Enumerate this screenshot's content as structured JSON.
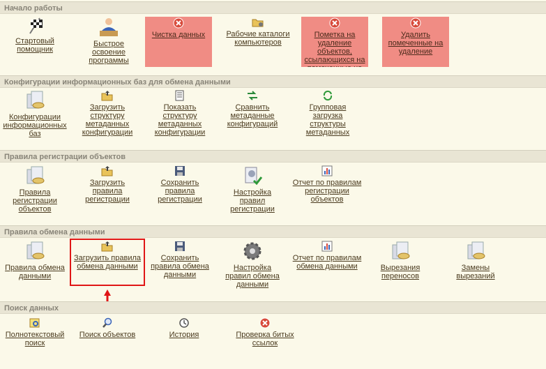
{
  "sections": [
    {
      "title": "Начало работы",
      "items": [
        {
          "label": "Стартовый помощник",
          "icon": "checkered-flag-icon"
        },
        {
          "label": "Быстрое освоение программы",
          "icon": "teacher-at-desk-icon"
        },
        {
          "label": "Чистка данных",
          "icon": "red-x-icon"
        },
        {
          "label": "Рабочие каталоги компьютеров",
          "icon": "folder-gear-icon"
        },
        {
          "label": "Пометка на удаление объектов, ссылающихся на помеченные на",
          "icon": "red-x-icon"
        },
        {
          "label": "Удалить помеченные на удаление",
          "icon": "red-x-icon"
        }
      ]
    },
    {
      "title": "Конфигурации информационных баз для обмена данными",
      "items": [
        {
          "label": "Конфигурации информационных баз",
          "icon": "database-stack-icon"
        },
        {
          "label": "Загрузить структуру метаданных конфигурации",
          "icon": "folder-upload-icon"
        },
        {
          "label": "Показать структуру метаданных конфигурации",
          "icon": "document-list-icon"
        },
        {
          "label": "Сравнить метаданные конфигураций",
          "icon": "compare-arrows-icon"
        },
        {
          "label": "Групповая загрузка структуры метаданных",
          "icon": "green-refresh-icon"
        }
      ]
    },
    {
      "title": "Правила регистрации объектов",
      "items": [
        {
          "label": "Правила регистрации объектов",
          "icon": "database-stack-icon"
        },
        {
          "label": "Загрузить правила регистрации",
          "icon": "folder-upload-icon"
        },
        {
          "label": "Сохранить правила регистрации",
          "icon": "floppy-disk-icon"
        },
        {
          "label": "Настройка правил регистрации",
          "icon": "document-check-icon"
        },
        {
          "label": "Отчет по правилам регистрации объектов",
          "icon": "bar-chart-icon"
        }
      ]
    },
    {
      "title": "Правила обмена данными",
      "items": [
        {
          "label": "Правила обмена данными",
          "icon": "database-stack-icon"
        },
        {
          "label": "Загрузить правила обмена данными",
          "icon": "folder-upload-icon"
        },
        {
          "label": "Сохранить правила обмена данными",
          "icon": "floppy-disk-icon"
        },
        {
          "label": "Настройка правил обмена данными",
          "icon": "gear-icon"
        },
        {
          "label": "Отчет по правилам обмена данными",
          "icon": "bar-chart-icon"
        },
        {
          "label": "Вырезания переносов",
          "icon": "database-stack-icon"
        },
        {
          "label": "Замены вырезаний",
          "icon": "database-stack-icon"
        }
      ]
    },
    {
      "title": "Поиск данных",
      "items": [
        {
          "label": "Полнотекстовый поиск",
          "icon": "search-document-icon"
        },
        {
          "label": "Поиск объектов",
          "icon": "magnifier-icon"
        },
        {
          "label": "История",
          "icon": "history-clock-icon"
        },
        {
          "label": "Проверка битых ссылок",
          "icon": "red-x-icon"
        }
      ]
    }
  ],
  "colors": {
    "danger_tile": "#f08c84",
    "highlight": "#e01616",
    "section_bg": "#e9e5d4"
  }
}
